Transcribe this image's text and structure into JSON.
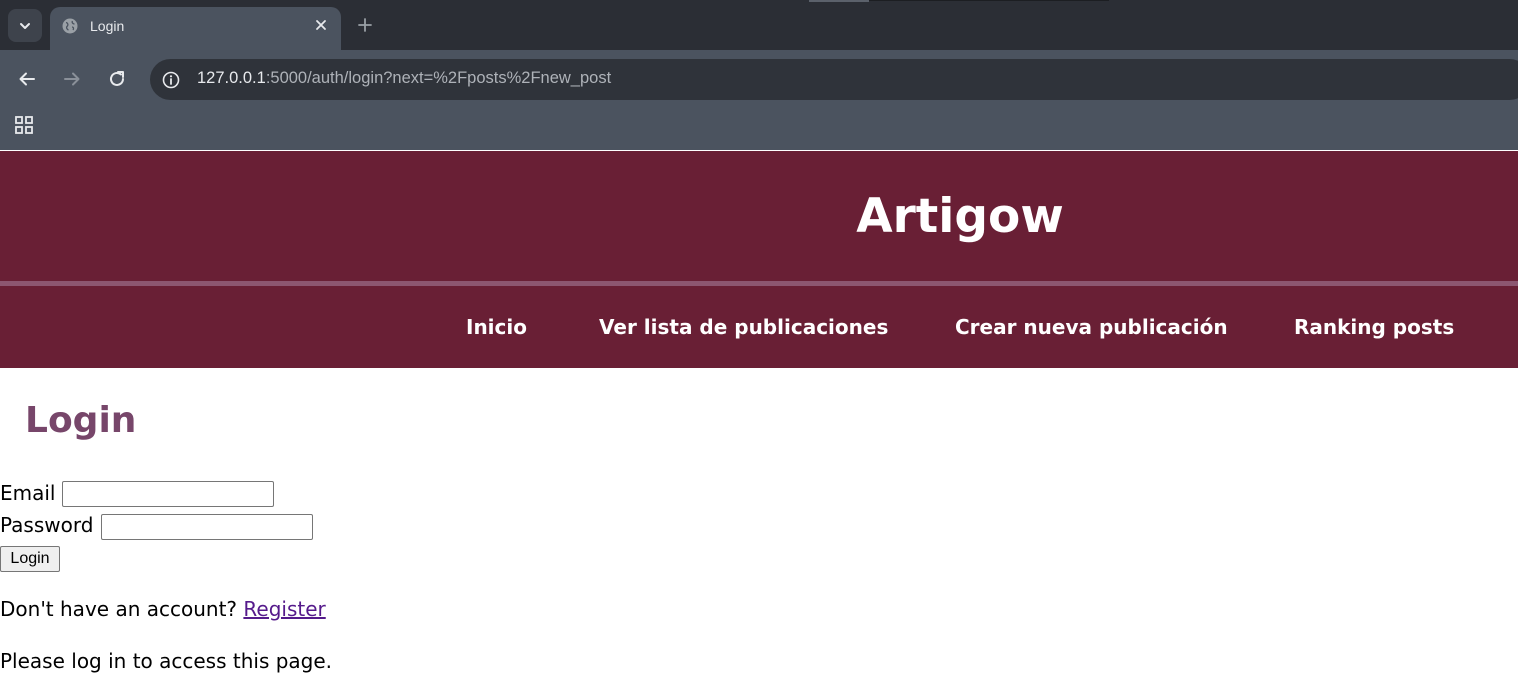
{
  "browser": {
    "tab": {
      "title": "Login",
      "icon": "globe-icon"
    },
    "url": {
      "host": "127.0.0.1",
      "rest": ":5000/auth/login?next=%2Fposts%2Fnew_post"
    },
    "colors": {
      "tabstrip": "#2b2e35",
      "toolbar": "#4b535f",
      "omnibox": "#2f333a"
    }
  },
  "site": {
    "title": "Artigow",
    "nav": [
      {
        "label": "Inicio"
      },
      {
        "label": "Ver lista de publicaciones"
      },
      {
        "label": "Crear nueva publicación"
      },
      {
        "label": "Ranking posts"
      }
    ],
    "colors": {
      "header": "#691f35",
      "heading": "#77466a",
      "link": "#551a8b"
    }
  },
  "login": {
    "heading": "Login",
    "email_label": "Email",
    "email_value": "",
    "password_label": "Password",
    "password_value": "",
    "submit_label": "Login",
    "register_prompt": "Don't have an account?",
    "register_link": "Register",
    "flash_message": "Please log in to access this page."
  }
}
